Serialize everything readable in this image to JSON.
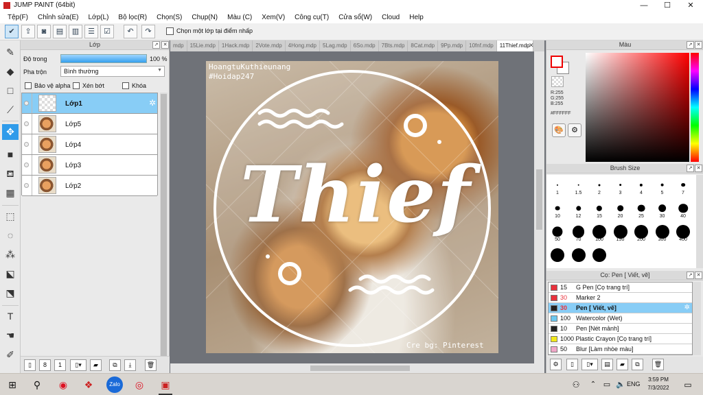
{
  "window": {
    "title": "JUMP PAINT (64bit)",
    "minimize": "—",
    "maximize": "☐",
    "close": "✕"
  },
  "menu": [
    "Tệp(F)",
    "Chỉnh sửa(E)",
    "Lớp(L)",
    "Bộ lọc(R)",
    "Chọn(S)",
    "Chụp(N)",
    "Màu (C)",
    "Xem(V)",
    "Công cụ(T)",
    "Cửa sổ(W)",
    "Cloud",
    "Help"
  ],
  "toolbar": {
    "pick_layer_label": "Chọn một lớp tại điểm nhấp"
  },
  "layer_panel": {
    "title": "Lớp",
    "opacity_label": "Độ trong",
    "opacity_value": "100 %",
    "blend_label": "Pha trộn",
    "blend_value": "Bình thường",
    "protect_alpha": "Bảo vệ alpha",
    "clipping": "Xén bớt",
    "lock": "Khóa",
    "layers": [
      {
        "name": "Lớp1",
        "selected": true
      },
      {
        "name": "Lớp5",
        "selected": false
      },
      {
        "name": "Lớp4",
        "selected": false
      },
      {
        "name": "Lớp3",
        "selected": false
      },
      {
        "name": "Lớp2",
        "selected": false
      }
    ]
  },
  "tabs": [
    "mdp",
    "15Lie.mdp",
    "1Hack.mdp",
    "2Vote.mdp",
    "4Hong.mdp",
    "5Lag.mdp",
    "6So.mdp",
    "7Bts.mdp",
    "8Cat.mdp",
    "9Pp.mdp",
    "10fnf.mdp",
    "11Thief.mdp"
  ],
  "active_tab": "11Thief.mdp",
  "canvas": {
    "watermark_line1": "HoangtuKuthieunang",
    "watermark_line2": "#Hoidap247",
    "title_text": "Thief",
    "credit": "Cre bg: Pinterest"
  },
  "color_panel": {
    "title": "Màu",
    "r": "R:255",
    "g": "G:255",
    "b": "B:255",
    "hex": "#FFFFFF"
  },
  "brush_panel": {
    "title": "Brush Size",
    "sizes": [
      "1",
      "1.5",
      "2",
      "3",
      "4",
      "5",
      "7",
      "10",
      "12",
      "15",
      "20",
      "25",
      "30",
      "40",
      "50",
      "70",
      "100",
      "150",
      "200",
      "300",
      "400",
      "",
      "",
      ""
    ]
  },
  "tool_panel": {
    "title": "Cọ: Pen [ Viết, vẽ]",
    "tools": [
      {
        "size": "15",
        "name": "G Pen [Cọ trang trí]",
        "color": "#e8323c",
        "selected": false
      },
      {
        "size": "30",
        "name": "Marker 2",
        "color": "#e8323c",
        "selected": false
      },
      {
        "size": "30",
        "name": "Pen [ Viết, vẽ]",
        "color": "#222222",
        "selected": true
      },
      {
        "size": "100",
        "name": "Watercolor (Wet)",
        "color": "#6cc8f0",
        "selected": false
      },
      {
        "size": "10",
        "name": "Pen [Nét mảnh]",
        "color": "#222222",
        "selected": false
      },
      {
        "size": "1000",
        "name": "Plastic Crayon [Cọ trang trí]",
        "color": "#f2e81c",
        "selected": false
      },
      {
        "size": "50",
        "name": "Blur [Làm nhòe màu]",
        "color": "#f0a8c8",
        "selected": false
      }
    ]
  },
  "taskbar": {
    "lang": "ENG",
    "time": "3:59 PM",
    "date": "7/3/2022"
  }
}
